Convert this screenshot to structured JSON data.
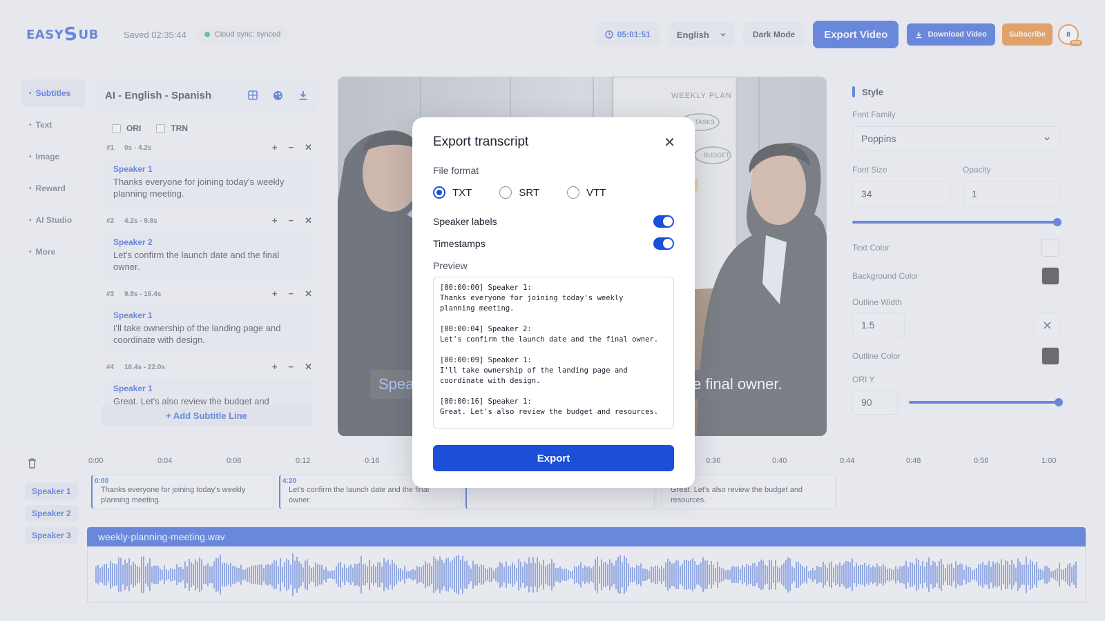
{
  "app": {
    "logo_prefix": "EASY",
    "logo_s": "S",
    "logo_suffix": "UB"
  },
  "header": {
    "saved": "Saved 02:35:44",
    "sync": "Cloud sync: synced",
    "timer": "05:01:51",
    "language": "English",
    "dark_mode": "Dark Mode",
    "export_video": "Export Video",
    "download_video": "Download Video",
    "subscribe": "Subscribe",
    "avatar_initial": "8",
    "avatar_badge": "Pro"
  },
  "nav": {
    "items": [
      "Subtitles",
      "Text",
      "Image",
      "Reward",
      "AI Studio",
      "More"
    ],
    "active": "Subtitles"
  },
  "subtitles": {
    "title": "AI - English - Spanish",
    "check_ori": "ORI",
    "check_trn": "TRN",
    "entries": [
      {
        "num": "#1",
        "time": "0s - 4.2s",
        "speaker": "Speaker 1",
        "text": "Thanks everyone for joining today's weekly planning meeting."
      },
      {
        "num": "#2",
        "time": "4.2s - 9.8s",
        "speaker": "Speaker 2",
        "text": "Let's confirm the launch date and the final owner."
      },
      {
        "num": "#3",
        "time": "9.8s - 16.4s",
        "speaker": "Speaker 1",
        "text": "I'll take ownership of the landing page and coordinate with design."
      },
      {
        "num": "#4",
        "time": "16.4s - 22.0s",
        "speaker": "Speaker 1",
        "text": "Great. Let's also review the budget and resources."
      }
    ],
    "add_line": "+ Add Subtitle Line"
  },
  "video": {
    "caption_left": "Spea",
    "caption_right": "e final owner.",
    "board_title": "WEEKLY PLAN",
    "board_tasks": "TASKS",
    "board_budget": "BUDGET"
  },
  "style": {
    "title": "Style",
    "font_family_label": "Font Family",
    "font_family": "Poppins",
    "font_size_label": "Font Size",
    "font_size": "34",
    "opacity_label": "Opacity",
    "opacity": "1",
    "text_color_label": "Text Color",
    "text_color": "#f4f5f8",
    "background_color_label": "Background Color",
    "background_color": "#1c1e22",
    "outline_width_label": "Outline Width",
    "outline_width": "1.5",
    "outline_color_label": "Outline Color",
    "outline_color": "#1c1e22",
    "ori_y_label": "ORI Y",
    "ori_y": "90"
  },
  "timeline": {
    "ticks": [
      "0:00",
      "0:04",
      "0:08",
      "0:12",
      "0:16",
      "0:36",
      "0:40",
      "0:44",
      "0:48",
      "0:56",
      "1:00"
    ],
    "speakers": [
      "Speaker 1",
      "Speaker 2",
      "Speaker 3"
    ],
    "clips": [
      {
        "start": "0:00",
        "text": "Thanks everyone for joining today's weekly planning meeting."
      },
      {
        "start": "4:20",
        "text": "Let's confirm the launch date and the final owner."
      },
      {
        "start": "",
        "text": "Great. Let's also review the budget and resources."
      }
    ],
    "audio_file": "weekly-planning-meeting.wav"
  },
  "modal": {
    "title": "Export transcript",
    "file_format_label": "File format",
    "formats": [
      "TXT",
      "SRT",
      "VTT"
    ],
    "selected_format": "TXT",
    "speaker_labels": "Speaker labels",
    "speaker_labels_on": true,
    "timestamps": "Timestamps",
    "timestamps_on": true,
    "preview_label": "Preview",
    "preview": "[00:00:00] Speaker 1:\nThanks everyone for joining today's weekly\nplanning meeting.\n\n[00:00:04] Speaker 2:\nLet's confirm the launch date and the final owner.\n\n[00:00:09] Speaker 1:\nI'll take ownership of the landing page and\ncoordinate with design.\n\n[00:00:16] Speaker 1:\nGreat. Let's also review the budget and resources.",
    "export_button": "Export"
  },
  "colors": {
    "accent": "#1a4fd6",
    "orange": "#e57b12",
    "sync_dot": "#23b35a"
  },
  "icons": [
    "clock-icon",
    "chevron-down-icon",
    "download-icon",
    "grid-icon",
    "palette-icon",
    "save-icon",
    "trash-icon",
    "close-icon"
  ]
}
